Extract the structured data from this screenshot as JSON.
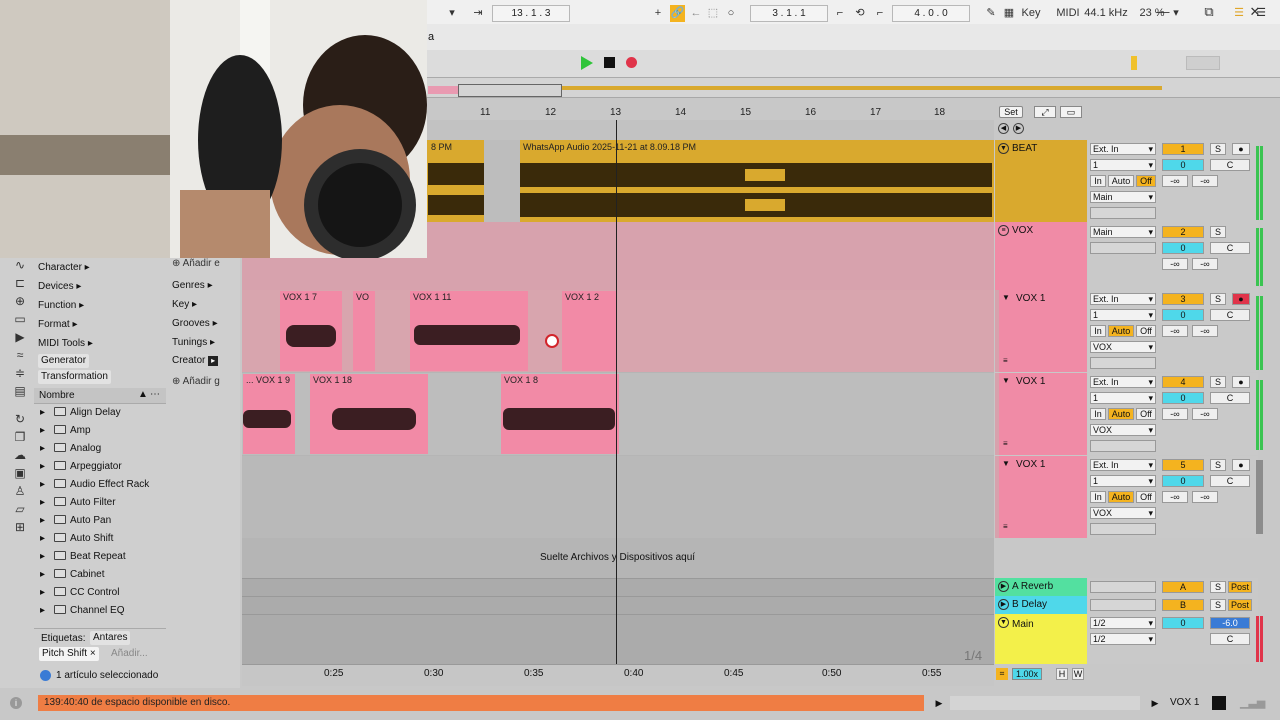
{
  "window": {
    "min": "—",
    "max": "⧉",
    "close": "✕",
    "menu_fragment": "a"
  },
  "transport": {
    "arrangement_pos": "13 .  1 .  3",
    "loop_start": "3 .  1 .  1",
    "loop_length": "4 .  0 .  0",
    "key_label": "Key",
    "midi_label": "MIDI",
    "sample_rate": "44.1 kHz",
    "cpu": "23 %"
  },
  "ruler": {
    "bars": [
      "11",
      "12",
      "13",
      "14",
      "15",
      "16",
      "17",
      "18"
    ],
    "set_label": "Set"
  },
  "time_ruler": [
    "0:25",
    "0:30",
    "0:35",
    "0:40",
    "0:45",
    "0:50",
    "0:55"
  ],
  "browser": {
    "categories": [
      "Character ▸",
      "Devices ▸",
      "Function ▸",
      "Format ▸",
      "MIDI Tools ▸"
    ],
    "subitems": [
      "Generator",
      "Transformation"
    ],
    "mid": {
      "add1": "Añadir e",
      "genres": "Genres ▸",
      "key": "Key ▸",
      "grooves": "Grooves ▸",
      "tunings": "Tunings ▸",
      "creator": "Creator",
      "add2": "Añadir g"
    },
    "list_header": "Nombre",
    "items": [
      "Align Delay",
      "Amp",
      "Analog",
      "Arpeggiator",
      "Audio Effect Rack",
      "Auto Filter",
      "Auto Pan",
      "Auto Shift",
      "Beat Repeat",
      "Cabinet",
      "CC Control",
      "Channel EQ"
    ],
    "tags_label": "Etiquetas:",
    "tag_active": "Antares",
    "tag_pitch": "Pitch Shift",
    "tag_add": "Añadir...",
    "selected_info": "1 artículo seleccionado"
  },
  "tracks": {
    "beat": {
      "name": "BEAT",
      "input": "Ext. In",
      "channel": "1",
      "in": "In",
      "auto": "Auto",
      "off": "Off",
      "out": "Main",
      "num": "1",
      "vol": "0",
      "pan": "C",
      "s": "S",
      "inf1": "-∞",
      "inf2": "-∞"
    },
    "vox": {
      "name": "VOX",
      "input": "Main",
      "num": "2",
      "vol": "0",
      "pan": "C",
      "s": "S",
      "inf1": "-∞",
      "inf2": "-∞"
    },
    "vox1a": {
      "name": "VOX 1",
      "input": "Ext. In",
      "channel": "1",
      "in": "In",
      "auto": "Auto",
      "off": "Off",
      "out": "VOX",
      "num": "3",
      "vol": "0",
      "pan": "C",
      "s": "S",
      "inf1": "-∞",
      "inf2": "-∞"
    },
    "vox1b": {
      "name": "VOX 1",
      "input": "Ext. In",
      "channel": "1",
      "in": "In",
      "auto": "Auto",
      "off": "Off",
      "out": "VOX",
      "num": "4",
      "vol": "0",
      "pan": "C",
      "s": "S",
      "inf1": "-∞",
      "inf2": "-∞"
    },
    "vox1c": {
      "name": "VOX 1",
      "input": "Ext. In",
      "channel": "1",
      "in": "In",
      "auto": "Auto",
      "off": "Off",
      "out": "VOX",
      "num": "5",
      "vol": "0",
      "pan": "C",
      "s": "S",
      "inf1": "-∞",
      "inf2": "-∞"
    },
    "reverb": {
      "name": "A Reverb",
      "num": "A",
      "s": "S",
      "post": "Post"
    },
    "delay": {
      "name": "B Delay",
      "num": "B",
      "s": "S",
      "post": "Post"
    },
    "main": {
      "name": "Main",
      "out1": "1/2",
      "out2": "1/2",
      "vol": "0",
      "gain": "-6.0",
      "pan": "C"
    }
  },
  "clips": {
    "beat_left": "8 PM",
    "beat_main": "WhatsApp Audio 2025-11-21 at 8.09.18 PM",
    "vox1_7": "VOX 1 7",
    "vo": "VO",
    "vox1_11": "VOX 1 11",
    "vox1_2": "VOX 1 2",
    "vox1_9": "... VOX 1 9",
    "vox1_18": "VOX 1 18",
    "vox1_8": "VOX 1 8"
  },
  "drop_hint": "Suelte Archivos y Dispositivos aquí",
  "page_indicator": "1/4",
  "zoom": "1.00x",
  "hw": {
    "h": "H",
    "w": "W"
  },
  "status": {
    "message": "139:40:40 de espacio disponible en disco.",
    "track": "VOX 1"
  },
  "colors": {
    "beat": "#d9a92e",
    "vox": "#f08ba6",
    "reverb": "#53e0a0",
    "delay": "#4fd8ea",
    "main": "#f3f04a",
    "status": "#ef7d44"
  }
}
